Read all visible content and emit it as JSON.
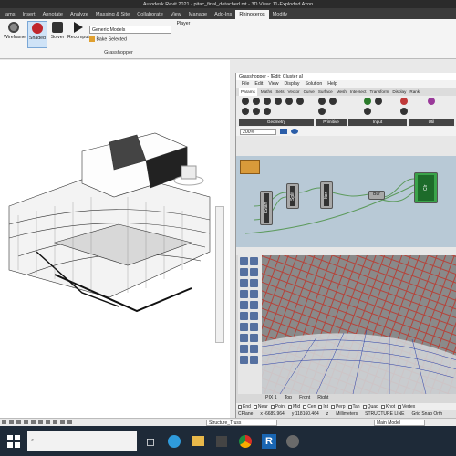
{
  "title": "Autodesk Revit 2021 - pitac_final_detached.rvt - 3D View: 11-Exploded Axon",
  "ribbon_tabs": [
    "ams",
    "Insert",
    "Annotate",
    "Analyze",
    "Massing & Site",
    "Collaborate",
    "View",
    "Manage",
    "Add-Ins",
    "Rhinoceros",
    "Modify"
  ],
  "ribbon": {
    "wireframe": "Wireframe",
    "shaded": "Shaded",
    "solver": "Solver",
    "recompute": "Recompute",
    "category": "Generic Models",
    "bake": "Bake Selected",
    "player": "Player",
    "panel": "Grasshopper"
  },
  "gh": {
    "title": "Grasshopper - [Edit: Cluster a]",
    "menu": [
      "File",
      "Edit",
      "View",
      "Display",
      "Solution",
      "Help"
    ],
    "tabs": [
      "Params",
      "Maths",
      "Sets",
      "Vector",
      "Curve",
      "Surface",
      "Mesh",
      "Intersect",
      "Transform",
      "Display",
      "Rank"
    ],
    "groups": [
      "Geometry",
      "Primitive",
      "Input",
      "Util"
    ],
    "zoom": "200%",
    "nodes": {
      "tstart": "TStart",
      "split": "Split",
      "iter": "Iter",
      "bur": "Bur",
      "clr": "Clr"
    }
  },
  "rhino": {
    "vtabs": [
      "PIX 1",
      "Top",
      "Front",
      "Right"
    ],
    "snaps": [
      "End",
      "Near",
      "Point",
      "Mid",
      "Cen",
      "Int",
      "Perp",
      "Tan",
      "Quad",
      "Knot",
      "Vertex"
    ],
    "status": [
      "CPlane",
      "x -6689.964",
      "y 118160.464",
      "z",
      "Millimeters",
      "STRUCTURE LINE",
      "Grid Snap Orth"
    ]
  },
  "bottombar": {
    "scale": "Structure_Truss",
    "model": "Main Model"
  },
  "taskbar": {
    "search": ""
  },
  "colors": {
    "accent": "#2f6fd0",
    "gh_canvas": "#b8c9d6",
    "node_green": "#3aa34a"
  }
}
